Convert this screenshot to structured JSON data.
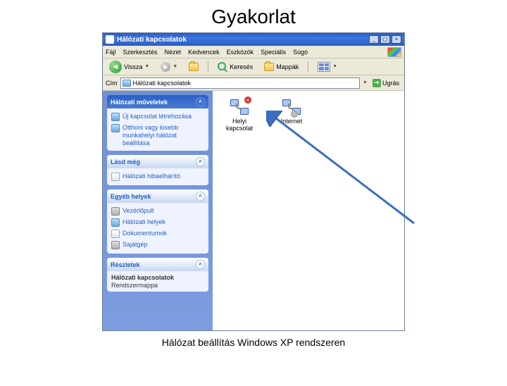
{
  "slide": {
    "title": "Gyakorlat",
    "caption": "Hálózat beállítás Windows XP rendszeren"
  },
  "window": {
    "title": "Hálózati kapcsolatok",
    "controls": {
      "minimize": "_",
      "maximize": "▢",
      "close": "×"
    }
  },
  "menubar": {
    "items": [
      "Fájl",
      "Szerkesztés",
      "Nézet",
      "Kedvencek",
      "Eszközök",
      "Speciális",
      "Súgó"
    ]
  },
  "toolbar": {
    "back": "Vissza",
    "search": "Keresés",
    "folders": "Mappák"
  },
  "addressbar": {
    "label": "Cím",
    "value": "Hálózati kapcsolatok",
    "go": "Ugrás"
  },
  "sidebar": {
    "panels": [
      {
        "title": "Hálózati műveletek",
        "dark": true,
        "collapsed": false,
        "items": [
          {
            "icon": "net",
            "label": "Új kapcsolat létrehozása"
          },
          {
            "icon": "net",
            "label": "Otthoni vagy kisebb munkahelyi hálózat beállítása"
          }
        ]
      },
      {
        "title": "Lásd még",
        "dark": false,
        "collapsed": false,
        "items": [
          {
            "icon": "doc",
            "label": "Hálózati hibaelhárító"
          }
        ]
      },
      {
        "title": "Egyéb helyek",
        "dark": false,
        "collapsed": false,
        "items": [
          {
            "icon": "ctrl",
            "label": "Vezérlőpult"
          },
          {
            "icon": "net",
            "label": "Hálózati helyek"
          },
          {
            "icon": "doc",
            "label": "Dokumentumok"
          },
          {
            "icon": "ctrl",
            "label": "Sajátgép"
          }
        ]
      },
      {
        "title": "Részletek",
        "dark": false,
        "collapsed": false,
        "details": {
          "name": "Hálózati kapcsolatok",
          "type": "Rendszermappa"
        }
      }
    ]
  },
  "main": {
    "items": [
      {
        "label": "Helyi kapcsolat",
        "badge": "x"
      },
      {
        "label": "Internet",
        "badge": "gear"
      }
    ]
  }
}
